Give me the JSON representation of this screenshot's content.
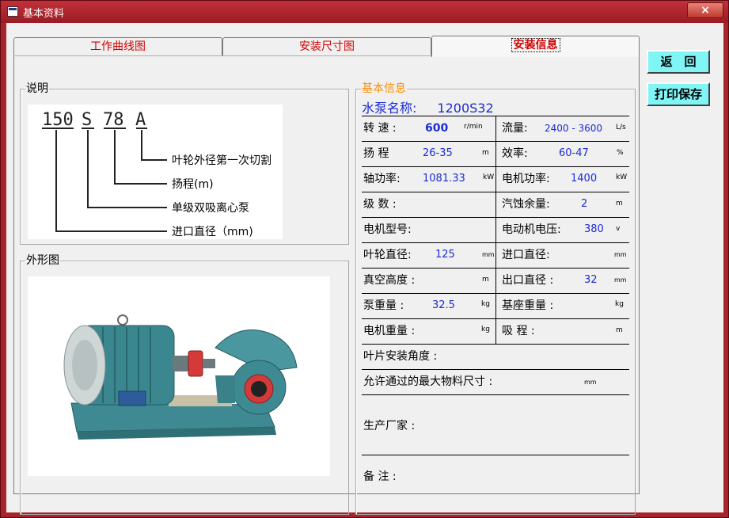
{
  "window": {
    "title": "基本资料",
    "close_label": "×"
  },
  "tabs": [
    {
      "label": "工作曲线图"
    },
    {
      "label": "安装尺寸图"
    },
    {
      "label": "安装信息"
    }
  ],
  "buttons": {
    "back": "返　回",
    "print_save": "打印保存"
  },
  "explain": {
    "legend": "说明",
    "model_parts": [
      "150",
      "S",
      "78",
      "A"
    ],
    "notes": [
      "叶轮外径第一次切割",
      "扬程(m)",
      "单级双吸离心泵",
      "进口直径（mm)"
    ]
  },
  "appearance": {
    "legend": "外形图"
  },
  "info": {
    "legend": "基本信息",
    "pump_name_label": "水泵名称:",
    "pump_name_value": "1200S32",
    "rows": [
      {
        "l_label": "转 速 :",
        "l_value": "600",
        "l_unit": "r/min",
        "r_label": "流量:",
        "r_value": "2400 - 3600",
        "r_unit": "L/s"
      },
      {
        "l_label": "扬 程",
        "l_value": "26-35",
        "l_unit": "m",
        "r_label": "效率:",
        "r_value": "60-47",
        "r_unit": "%"
      },
      {
        "l_label": "轴功率:",
        "l_value": "1081.33",
        "l_unit": "kW",
        "r_label": "电机功率:",
        "r_value": "1400",
        "r_unit": "kW"
      },
      {
        "l_label": "级 数 :",
        "l_value": "",
        "l_unit": "",
        "r_label": "汽蚀余量:",
        "r_value": "2",
        "r_unit": "m"
      },
      {
        "l_label": "电机型号:",
        "l_value": "",
        "l_unit": "",
        "r_label": "电动机电压:",
        "r_value": "380",
        "r_unit": "v"
      },
      {
        "l_label": "叶轮直径:",
        "l_value": "125",
        "l_unit": "mm",
        "r_label": "进口直径:",
        "r_value": "",
        "r_unit": "mm"
      },
      {
        "l_label": "真空高度 :",
        "l_value": "",
        "l_unit": "m",
        "r_label": "出口直径 :",
        "r_value": "32",
        "r_unit": "mm"
      },
      {
        "l_label": "泵重量 :",
        "l_value": "32.5",
        "l_unit": "kg",
        "r_label": "基座重量 :",
        "r_value": "",
        "r_unit": "kg"
      },
      {
        "l_label": "电机重量 :",
        "l_value": "",
        "l_unit": "kg",
        "r_label": "吸 程 :",
        "r_value": "",
        "r_unit": "m"
      }
    ],
    "blade_angle_label": "叶片安装角度 :",
    "max_material_label": "允许通过的最大物料尺寸 :",
    "max_material_unit": "mm",
    "manufacturer_label": "生产厂家 :",
    "remarks_label": "备 注 :"
  }
}
